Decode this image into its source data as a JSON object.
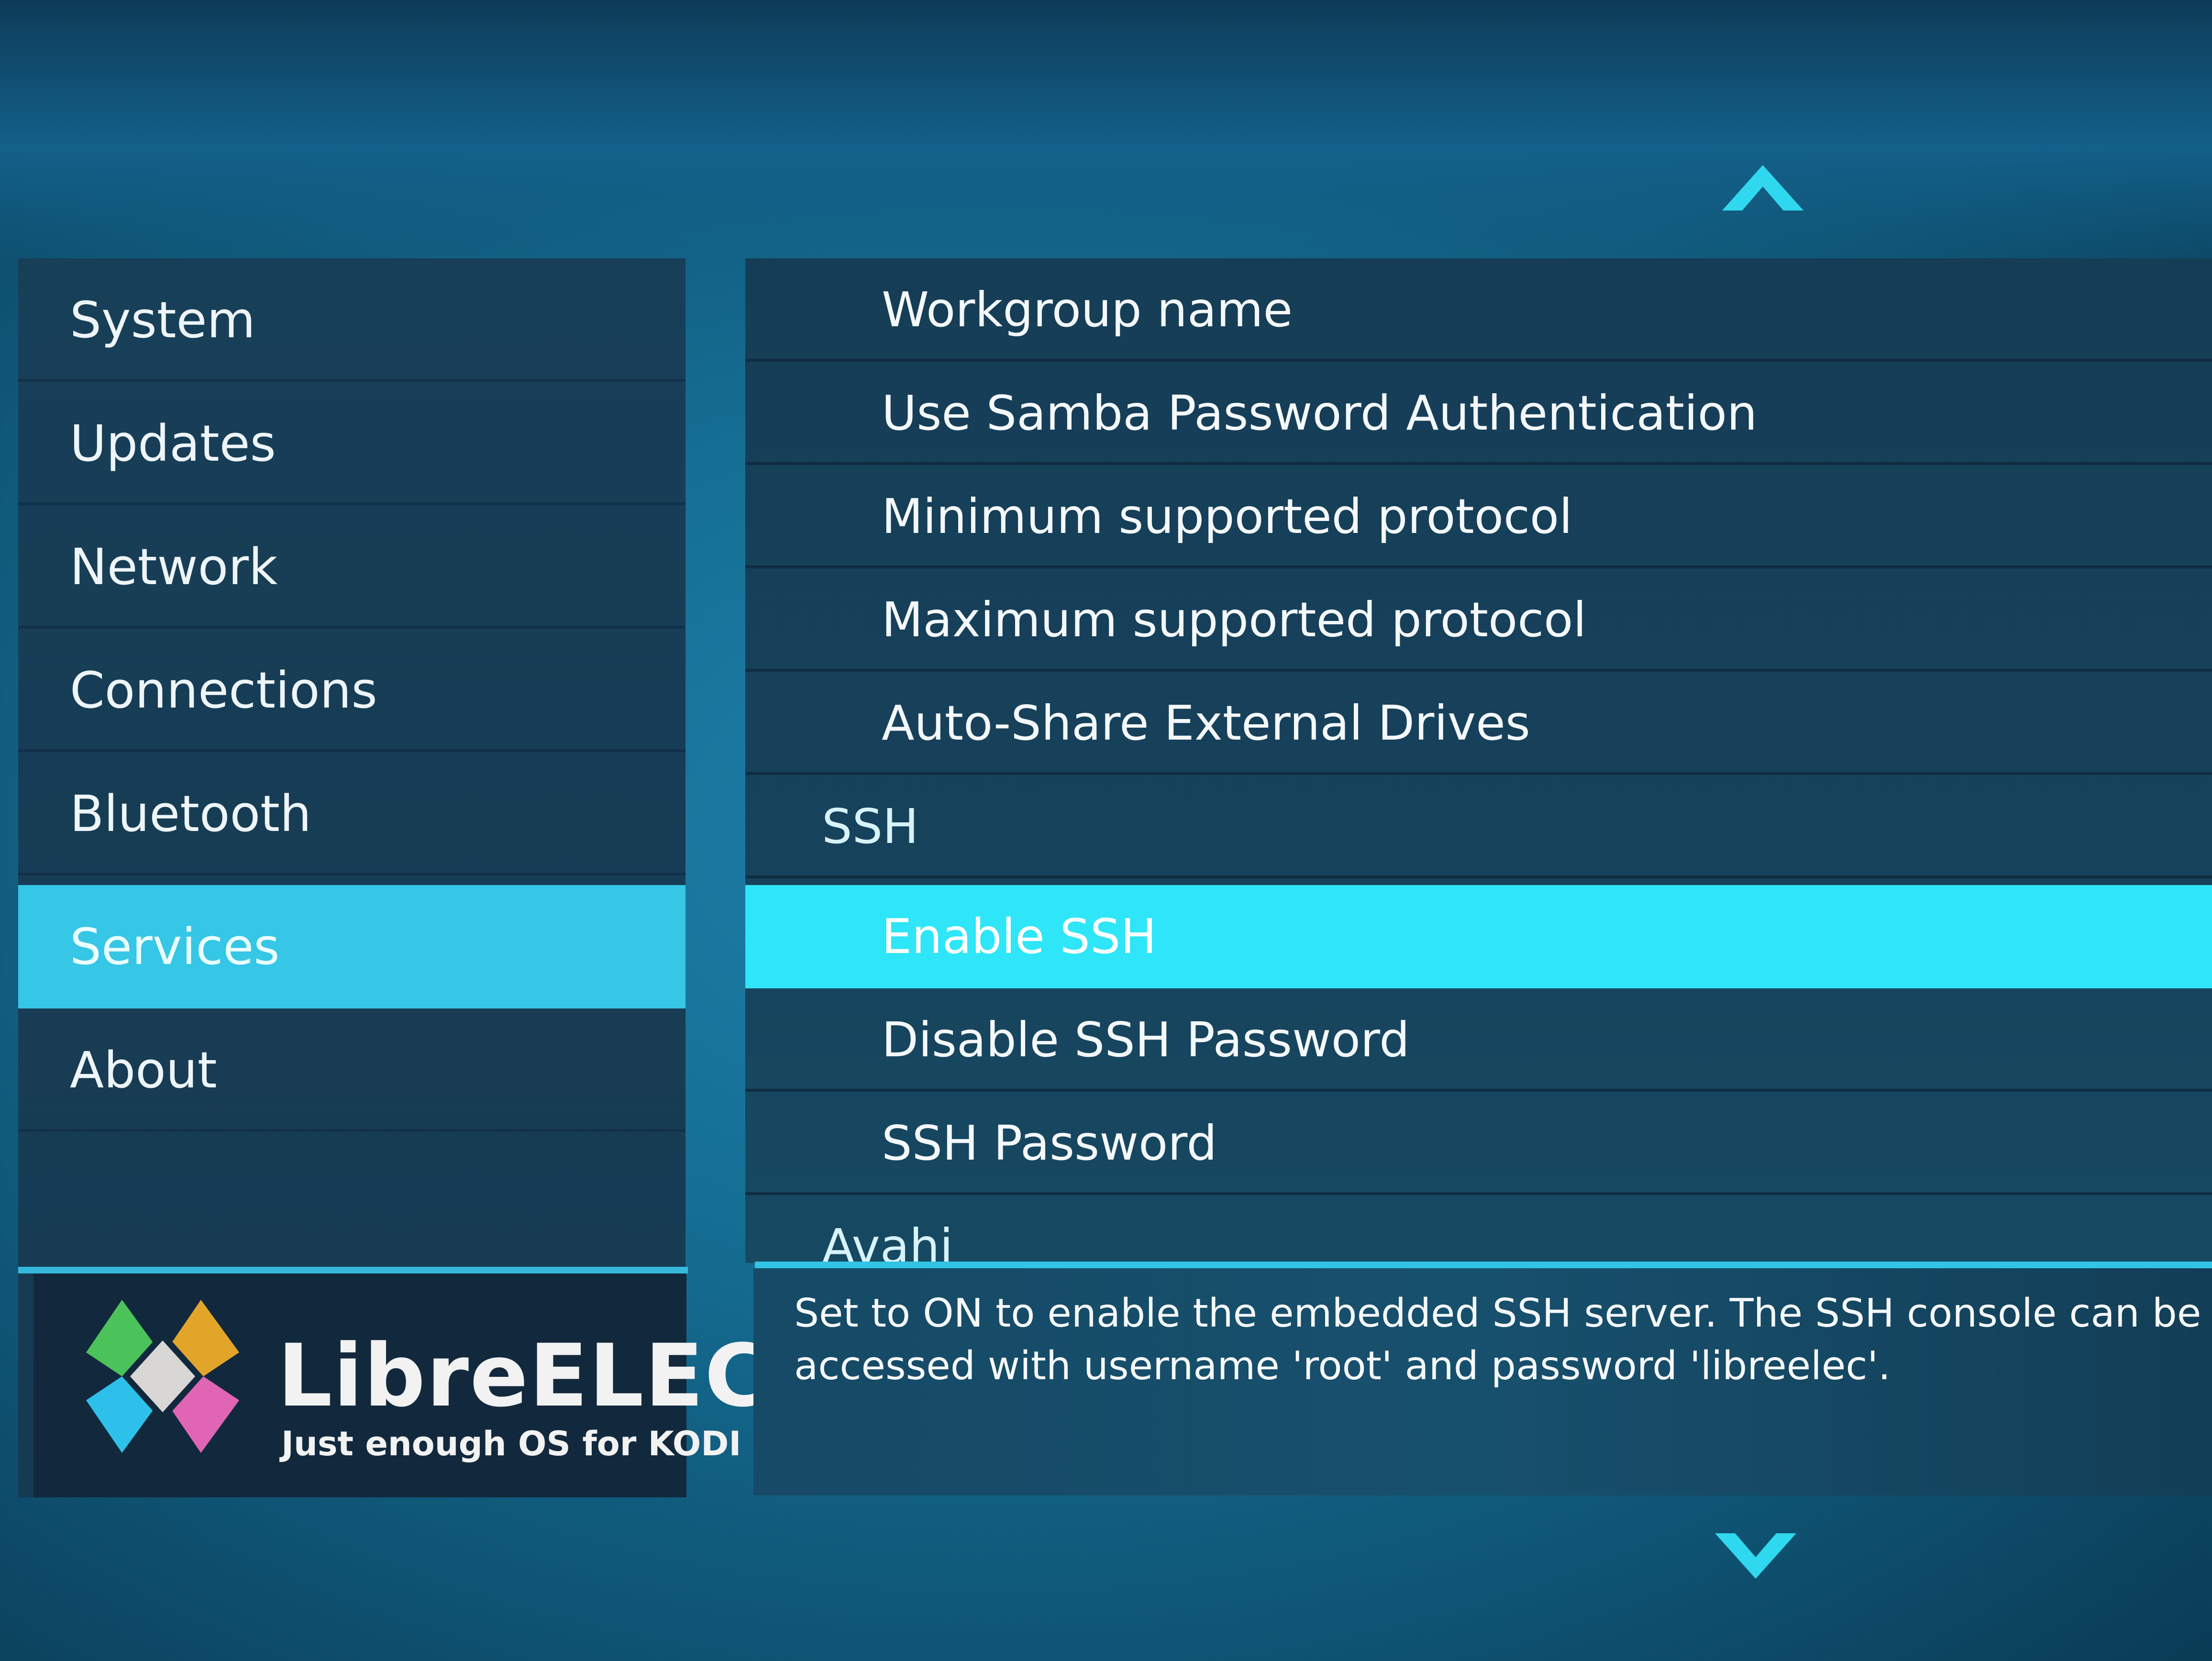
{
  "app": {
    "name": "LibreELEC",
    "tagline": "Just enough OS for KODI"
  },
  "colors": {
    "accent": "#2ee6f7",
    "sidebar_selected": "#36c6e6",
    "panel": "#163d56",
    "logo_green": "#4cc35a",
    "logo_orange": "#e2a52a",
    "logo_blue": "#2dc0ea",
    "logo_pink": "#e065b5",
    "logo_center": "#d9d6d6"
  },
  "sidebar": {
    "items": [
      {
        "label": "System",
        "selected": false
      },
      {
        "label": "Updates",
        "selected": false
      },
      {
        "label": "Network",
        "selected": false
      },
      {
        "label": "Connections",
        "selected": false
      },
      {
        "label": "Bluetooth",
        "selected": false
      },
      {
        "label": "Services",
        "selected": true
      },
      {
        "label": "About",
        "selected": false
      }
    ]
  },
  "settings": {
    "rows": [
      {
        "label": "Workgroup name",
        "type": "item"
      },
      {
        "label": "Use Samba Password Authentication",
        "type": "item"
      },
      {
        "label": "Minimum supported protocol",
        "type": "item"
      },
      {
        "label": "Maximum supported protocol",
        "type": "item"
      },
      {
        "label": "Auto-Share External Drives",
        "type": "item"
      },
      {
        "label": "SSH",
        "type": "section"
      },
      {
        "label": "Enable SSH",
        "type": "item",
        "selected": true
      },
      {
        "label": "Disable SSH Password",
        "type": "item"
      },
      {
        "label": "SSH Password",
        "type": "item"
      },
      {
        "label": "Avahi",
        "type": "section"
      }
    ]
  },
  "description": "Set to ON to enable the embedded SSH server. The SSH console can be accessed with username 'root' and password 'libreelec'.",
  "icons": {
    "scroll_up": "chevron-up-icon",
    "scroll_down": "chevron-down-icon",
    "logo": "libreelec-logo-icon"
  }
}
